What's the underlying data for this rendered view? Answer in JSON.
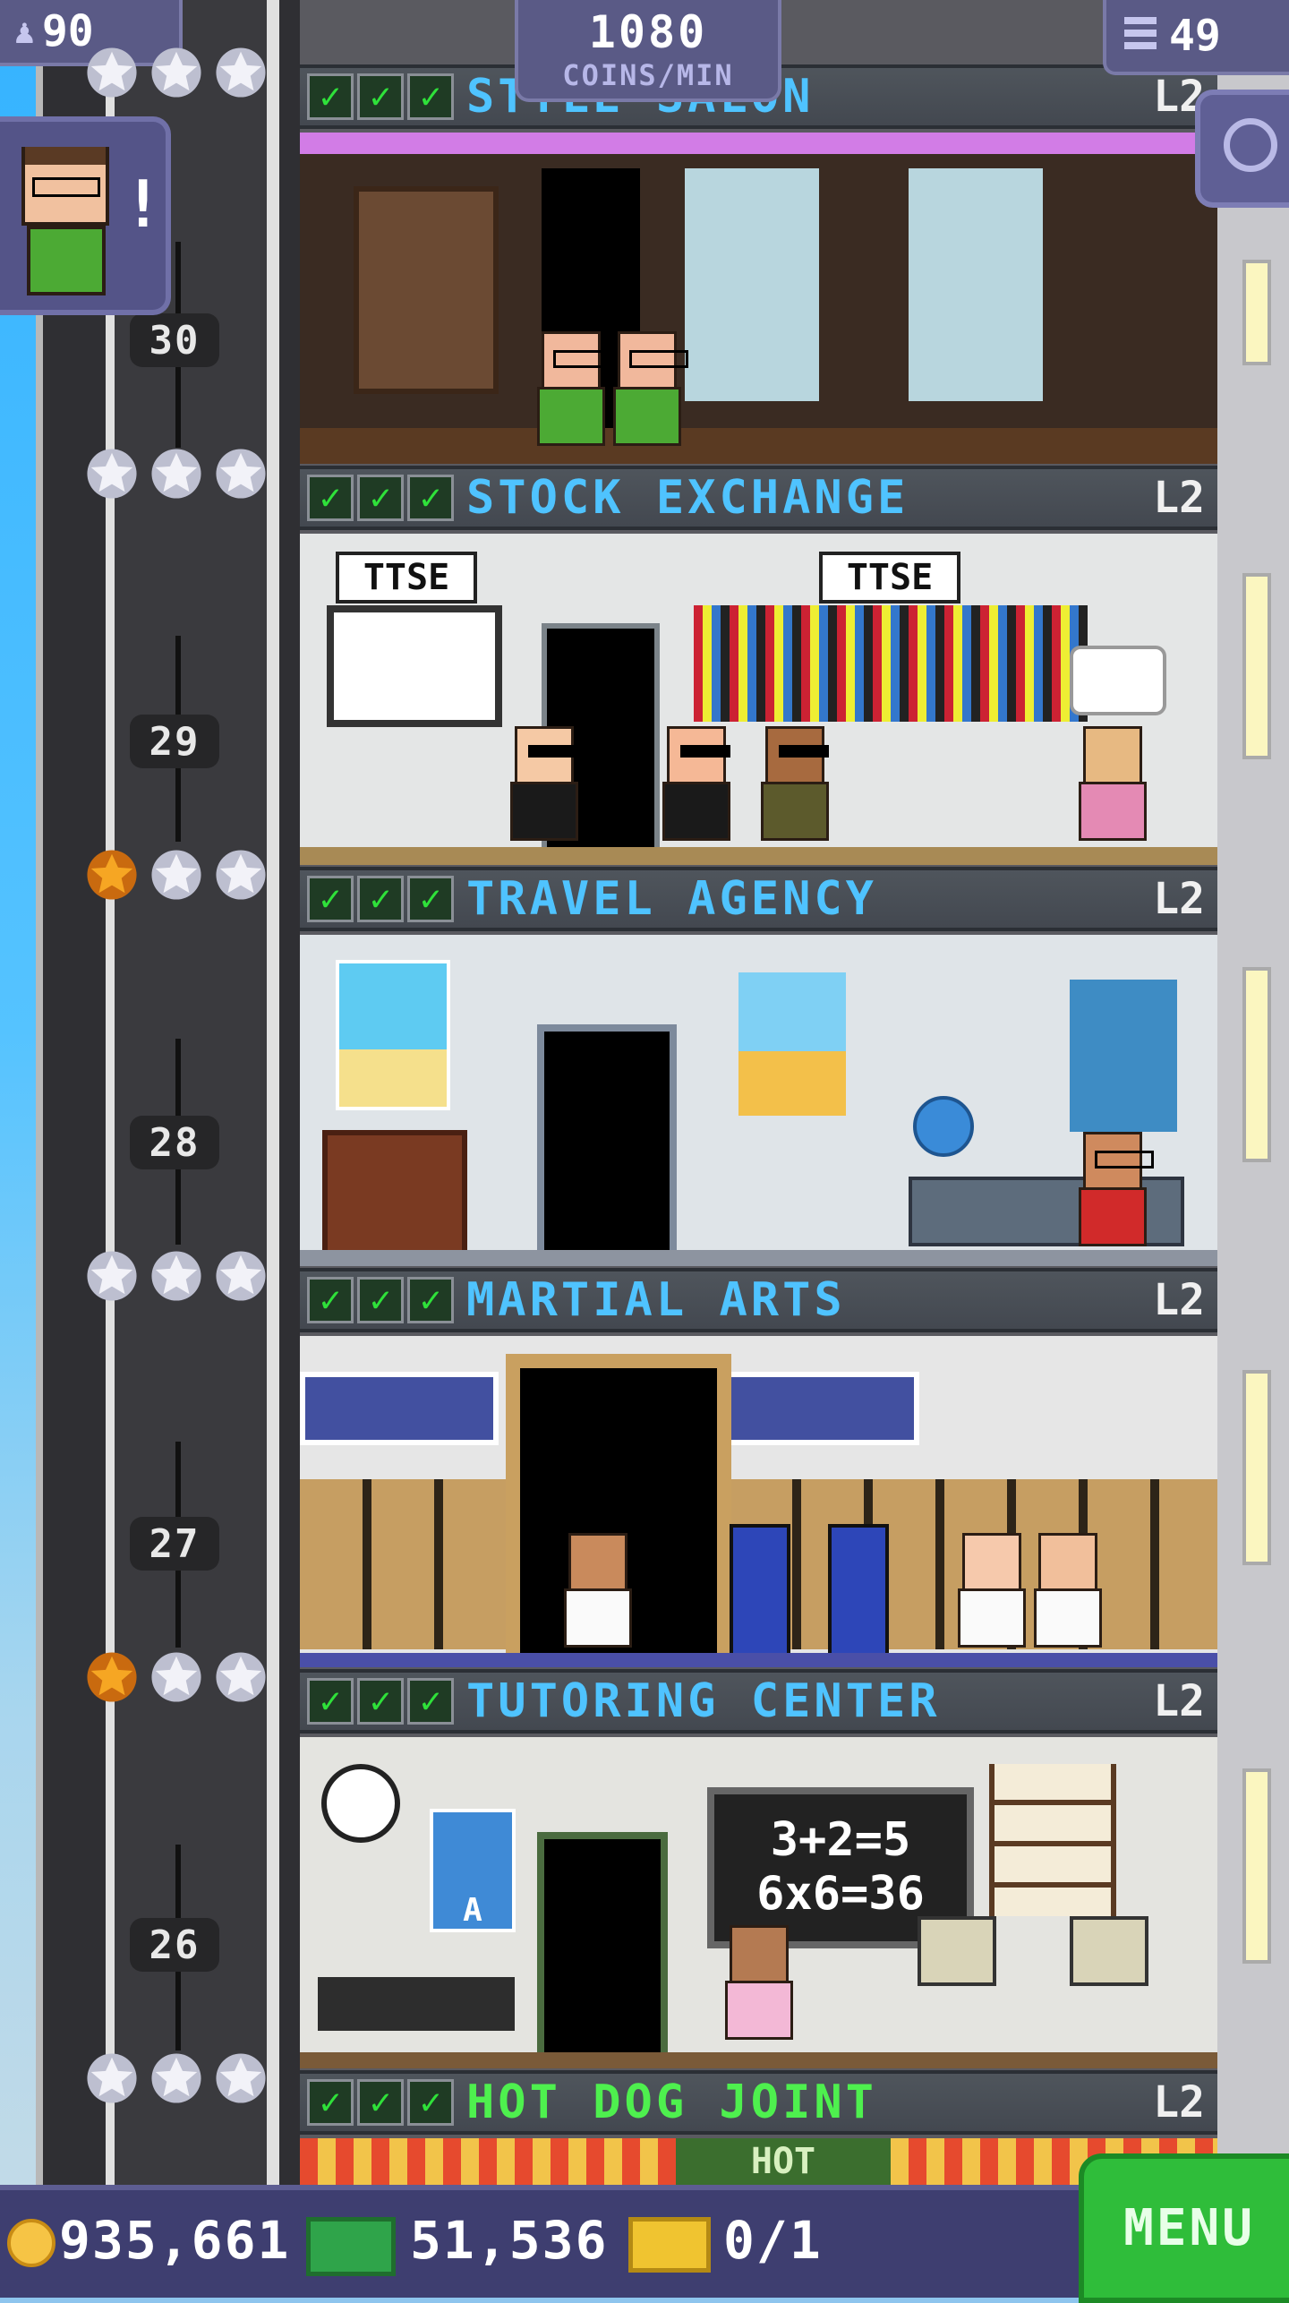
{
  "hud": {
    "population": "90",
    "coins_rate": "1080",
    "coins_rate_label": "COINS/MIN",
    "floors_count": "49"
  },
  "notification": {
    "badge": "!"
  },
  "floors": [
    {
      "number": "30",
      "name": "STYLE SALON",
      "level": "L2",
      "name_color": "#4fc3ff",
      "stars": 3,
      "gold_stars": 0
    },
    {
      "number": "29",
      "name": "STOCK EXCHANGE",
      "level": "L2",
      "name_color": "#4fc3ff",
      "stars": 3,
      "gold_stars": 0
    },
    {
      "number": "28",
      "name": "TRAVEL AGENCY",
      "level": "L2",
      "name_color": "#4fc3ff",
      "stars": 3,
      "gold_stars": 1
    },
    {
      "number": "27",
      "name": "MARTIAL ARTS",
      "level": "L2",
      "name_color": "#4fc3ff",
      "stars": 3,
      "gold_stars": 0
    },
    {
      "number": "26",
      "name": "TUTORING CENTER",
      "level": "L2",
      "name_color": "#4fc3ff",
      "stars": 3,
      "gold_stars": 1
    },
    {
      "number": "",
      "name": "HOT DOG JOINT",
      "level": "L2",
      "name_color": "#4ef04e",
      "stars": 3,
      "gold_stars": 0
    }
  ],
  "room_text": {
    "ttse_1": "TTSE",
    "ttse_2": "TTSE",
    "chalk_line1": "3+2=5",
    "chalk_line2": "6x6=36",
    "poster_letter": "A",
    "hot_sign": "HOT"
  },
  "bottom_bar": {
    "coins": "935,661",
    "bux": "51,536",
    "tickets": "0/1",
    "menu_label": "MENU"
  },
  "colors": {
    "hud_purple": "#5a5a86",
    "menu_green": "#2fbd3a",
    "banner_gray": "#4f555c",
    "check_green": "#2fe13a",
    "gold_star": "#f6a623"
  }
}
